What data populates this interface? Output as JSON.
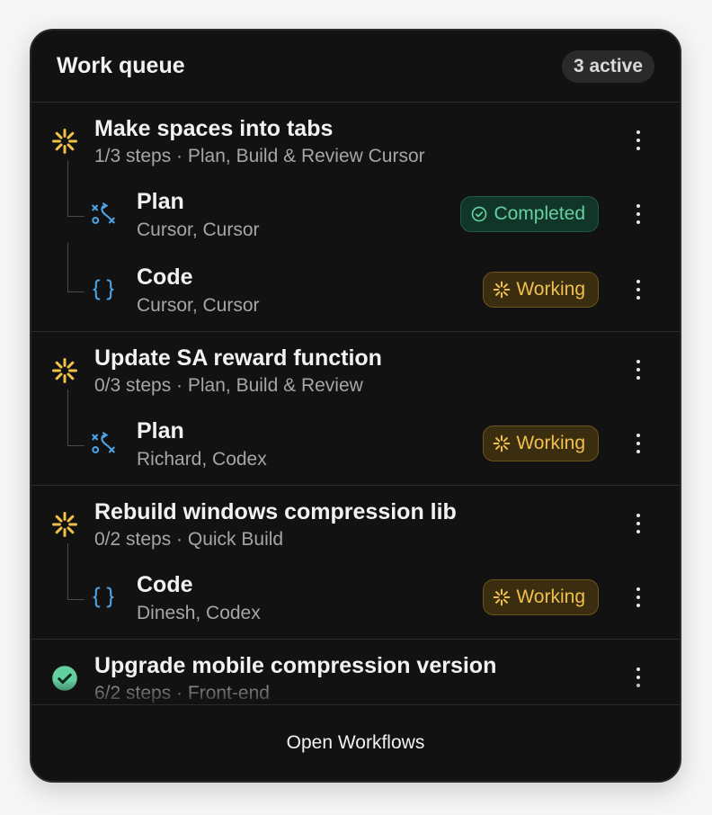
{
  "header": {
    "title": "Work queue",
    "active_badge": "3 active"
  },
  "groups": [
    {
      "title": "Make spaces into tabs",
      "subtitle": "1/3 steps · Plan, Build & Review Cursor",
      "status_icon": "spinner-icon",
      "steps": [
        {
          "title": "Plan",
          "subtitle": "Cursor, Cursor",
          "icon": "plan-icon",
          "status": "Completed"
        },
        {
          "title": "Code",
          "subtitle": "Cursor, Cursor",
          "icon": "code-braces-icon",
          "status": "Working"
        }
      ]
    },
    {
      "title": "Update SA reward function",
      "subtitle": "0/3 steps · Plan, Build & Review",
      "status_icon": "spinner-icon",
      "steps": [
        {
          "title": "Plan",
          "subtitle": "Richard, Codex",
          "icon": "plan-icon",
          "status": "Working"
        }
      ]
    },
    {
      "title": "Rebuild windows compression lib",
      "subtitle": "0/2 steps · Quick Build",
      "status_icon": "spinner-icon",
      "steps": [
        {
          "title": "Code",
          "subtitle": "Dinesh, Codex",
          "icon": "code-braces-icon",
          "status": "Working"
        }
      ]
    },
    {
      "title": "Upgrade mobile compression version",
      "subtitle": "6/2 steps · Front-end",
      "status_icon": "check-circle-icon",
      "steps": []
    }
  ],
  "footer": {
    "button_label": "Open Workflows"
  },
  "colors": {
    "background": "#121212",
    "working": "#f0c04c",
    "completed": "#63d0a0",
    "accent_blue": "#4da3e6"
  }
}
